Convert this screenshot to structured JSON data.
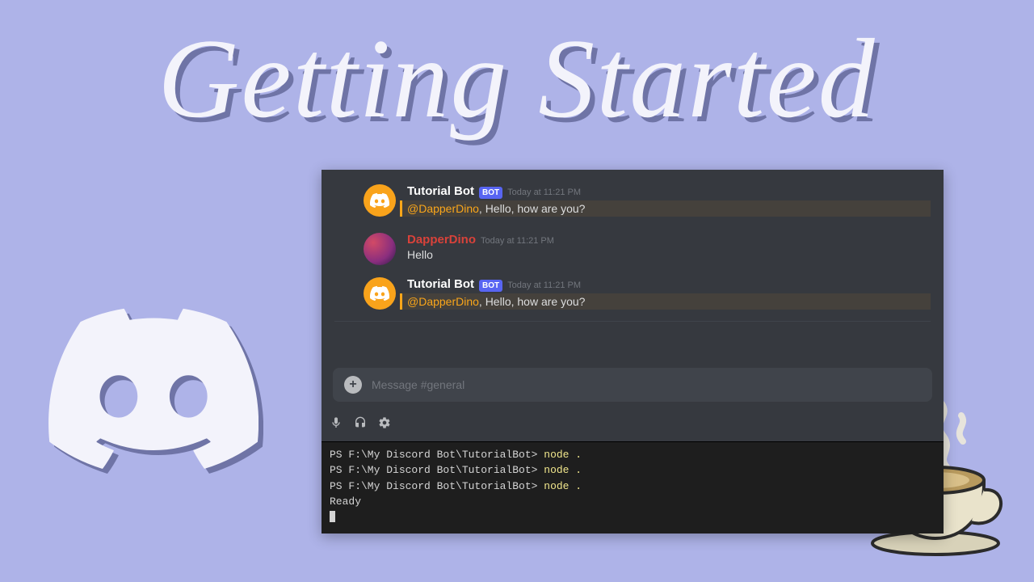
{
  "headline": "Getting Started",
  "chat": {
    "messages": [
      {
        "author": "Tutorial Bot",
        "is_bot": true,
        "bot_badge": "BOT",
        "timestamp": "Today at 11:21 PM",
        "mention": "@DapperDino",
        "text": ", Hello, how are you?"
      },
      {
        "author": "DapperDino",
        "is_bot": false,
        "timestamp": "Today at 11:21 PM",
        "text": "Hello"
      },
      {
        "author": "Tutorial Bot",
        "is_bot": true,
        "bot_badge": "BOT",
        "timestamp": "Today at 11:21 PM",
        "mention": "@DapperDino",
        "text": ", Hello, how are you?"
      }
    ],
    "input_placeholder": "Message #general"
  },
  "terminal": {
    "prompt": "PS F:\\My Discord Bot\\TutorialBot>",
    "command": "node .",
    "ready": "Ready"
  }
}
